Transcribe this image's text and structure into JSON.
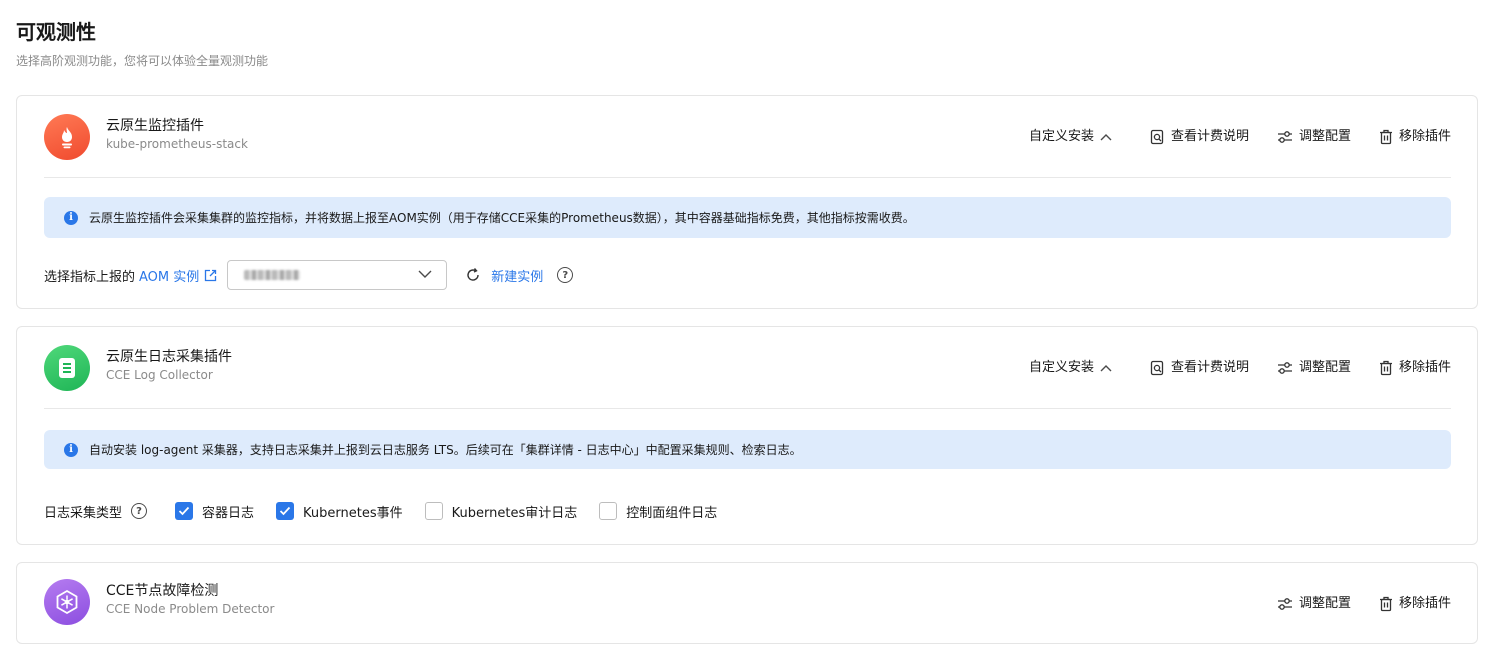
{
  "page": {
    "title": "可观测性",
    "subtitle": "选择高阶观测功能，您将可以体验全量观测功能"
  },
  "plugins": [
    {
      "name": "云原生监控插件",
      "sub": "kube-prometheus-stack",
      "icon": "prometheus-flame-icon",
      "install_label": "自定义安装",
      "billing_label": "查看计费说明",
      "config_label": "调整配置",
      "remove_label": "移除插件",
      "notice": "云原生监控插件会采集集群的监控指标，并将数据上报至AOM实例（用于存储CCE采集的Prometheus数据），其中容器基础指标免费，其他指标按需收费。",
      "aom": {
        "label": "选择指标上报的",
        "link": "AOM 实例",
        "new_instance": "新建实例"
      }
    },
    {
      "name": "云原生日志采集插件",
      "sub": "CCE Log Collector",
      "icon": "log-document-icon",
      "install_label": "自定义安装",
      "billing_label": "查看计费说明",
      "config_label": "调整配置",
      "remove_label": "移除插件",
      "notice": "自动安装 log-agent 采集器，支持日志采集并上报到云日志服务 LTS。后续可在「集群详情 - 日志中心」中配置采集规则、检索日志。",
      "log_types": {
        "label": "日志采集类型",
        "options": [
          {
            "label": "容器日志",
            "checked": true
          },
          {
            "label": "Kubernetes事件",
            "checked": true
          },
          {
            "label": "Kubernetes审计日志",
            "checked": false
          },
          {
            "label": "控制面组件日志",
            "checked": false
          }
        ]
      }
    },
    {
      "name": "CCE节点故障检测",
      "sub": "CCE Node Problem Detector",
      "icon": "node-detector-icon",
      "config_label": "调整配置",
      "remove_label": "移除插件"
    }
  ],
  "colors": {
    "accent": "#2a77e8",
    "notice_bg": "#deebfc",
    "prometheus": "#f04a2e",
    "log": "#1fb556",
    "npd": "#8c4ee0"
  }
}
